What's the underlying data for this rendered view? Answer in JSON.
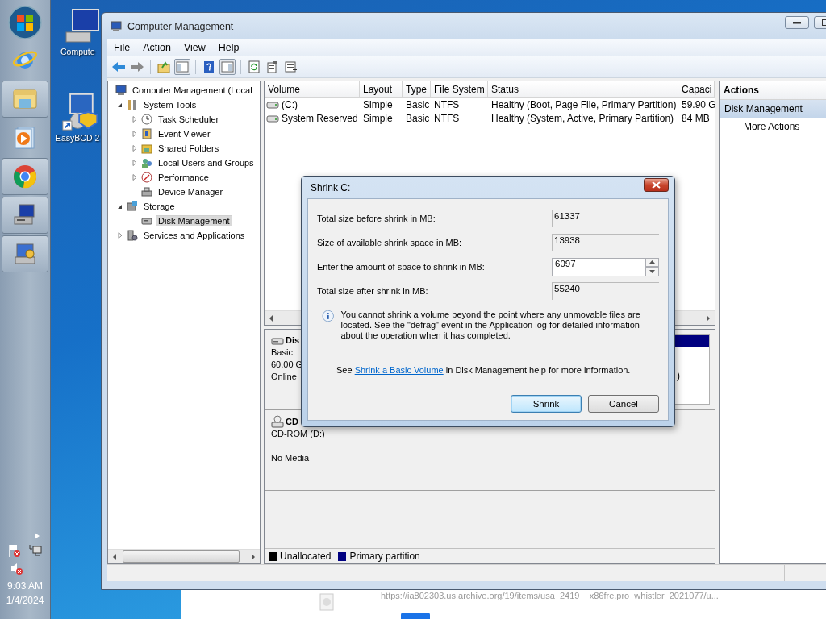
{
  "taskbar": {
    "apps": [
      {
        "kind": "ie",
        "pinned": false
      },
      {
        "kind": "folder",
        "pinned": true
      },
      {
        "kind": "media",
        "pinned": false
      },
      {
        "kind": "chrome",
        "pinned": true
      },
      {
        "kind": "computer",
        "pinned": true
      },
      {
        "kind": "admin",
        "pinned": true
      }
    ],
    "clock": {
      "time": "9:03 AM",
      "date": "1/4/2024"
    }
  },
  "desktop_icons": [
    {
      "label": "Compute",
      "kind": "computer"
    },
    {
      "label": "EasyBCD 2",
      "kind": "app"
    }
  ],
  "window": {
    "title": "Computer Management"
  },
  "menu": [
    "File",
    "Action",
    "View",
    "Help"
  ],
  "tree": [
    {
      "label": "Computer Management (Local",
      "selected": false,
      "children": [
        {
          "label": "System Tools",
          "expanded": true,
          "selected": false,
          "children": [
            {
              "label": "Task Scheduler",
              "expanded": false,
              "selected": false
            },
            {
              "label": "Event Viewer",
              "expanded": false,
              "selected": false
            },
            {
              "label": "Shared Folders",
              "expanded": false,
              "selected": false
            },
            {
              "label": "Local Users and Groups",
              "expanded": false,
              "selected": false
            },
            {
              "label": "Performance",
              "expanded": false,
              "selected": false
            },
            {
              "label": "Device Manager",
              "selected": false
            }
          ]
        },
        {
          "label": "Storage",
          "expanded": true,
          "selected": false,
          "children": [
            {
              "label": "Disk Management",
              "selected": true
            }
          ]
        },
        {
          "label": "Services and Applications",
          "expanded": false,
          "selected": false
        }
      ]
    }
  ],
  "volumes": {
    "columns": [
      "Volume",
      "Layout",
      "Type",
      "File System",
      "Status",
      "Capaci"
    ],
    "rows": [
      [
        "(C:)",
        "Simple",
        "Basic",
        "NTFS",
        "Healthy (Boot, Page File, Primary Partition)",
        "59.90 G"
      ],
      [
        "System Reserved",
        "Simple",
        "Basic",
        "NTFS",
        "Healthy (System, Active, Primary Partition)",
        "84 MB"
      ]
    ]
  },
  "disks": [
    {
      "kind": "disk",
      "name": "Dis",
      "type": "Basic",
      "size": "60.00 G",
      "status": "Online",
      "partition": ")"
    },
    {
      "kind": "cdrom",
      "name": "CD",
      "type": "CD-ROM (D:)",
      "status": "No Media"
    }
  ],
  "legend": [
    {
      "label": "Unallocated",
      "color": "#000000"
    },
    {
      "label": "Primary partition",
      "color": "#000080"
    }
  ],
  "actions": {
    "title": "Actions",
    "items": [
      {
        "label": "Disk Management",
        "kind": "header"
      },
      {
        "label": "More Actions",
        "kind": "action"
      }
    ]
  },
  "dialog": {
    "title": "Shrink C:",
    "fields": [
      {
        "label": "Total size before shrink in MB:",
        "value": "61337",
        "kind": "readonly"
      },
      {
        "label": "Size of available shrink space in MB:",
        "value": "13938",
        "kind": "readonly"
      },
      {
        "label": "Enter the amount of space to shrink in MB:",
        "value": "6097",
        "kind": "spin"
      },
      {
        "label": "Total size after shrink in MB:",
        "value": "55240",
        "kind": "readonly"
      }
    ],
    "info": "You cannot shrink a volume beyond the point where any unmovable files are located. See the \"defrag\" event in the Application log for detailed information about the operation when it has completed.",
    "help": {
      "before": "See",
      "link": "Shrink a Basic Volume",
      "after": "in Disk Management help for more information."
    },
    "buttons": [
      {
        "label": "Shrink",
        "default": true
      },
      {
        "label": "Cancel",
        "default": false
      }
    ]
  },
  "background_window": {
    "url": "https://ia802303.us.archive.org/19/items/usa_2419__x86fre.pro_whistler_2021077/u..."
  }
}
